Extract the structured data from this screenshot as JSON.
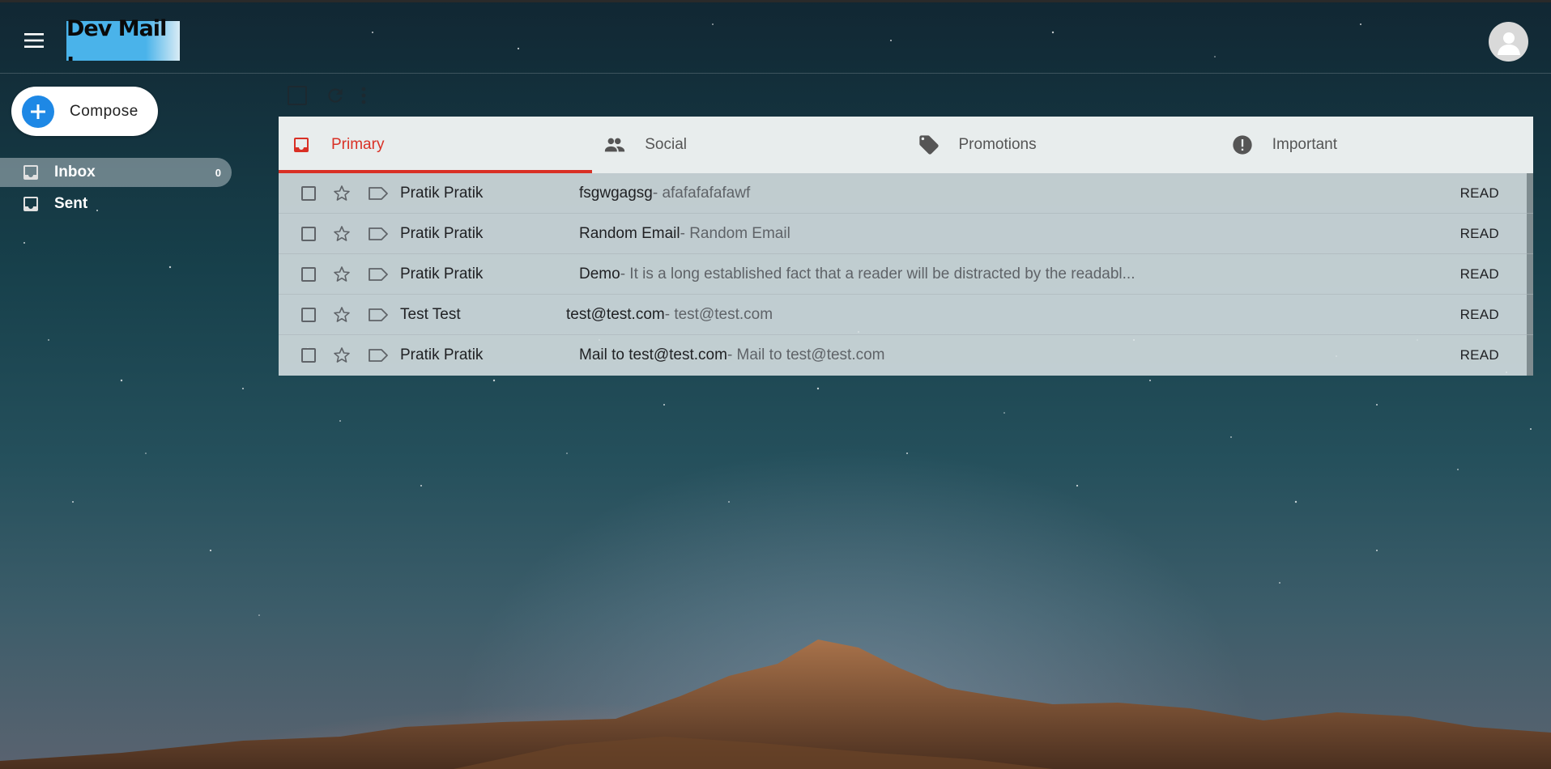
{
  "app": {
    "logo_text": "Dev Mail .",
    "menu_icon": "hamburger-menu-icon",
    "avatar_icon": "account-circle-icon"
  },
  "sidebar": {
    "compose_label": "Compose",
    "items": [
      {
        "label": "Inbox",
        "count": "0",
        "icon": "inbox-icon",
        "active": true
      },
      {
        "label": "Sent",
        "count": "",
        "icon": "inbox-icon",
        "active": false
      }
    ]
  },
  "toolbar": {
    "select_all_icon": "checkbox-icon",
    "refresh_icon": "refresh-icon",
    "more_icon": "more-vert-icon"
  },
  "tabs": [
    {
      "label": "Primary",
      "icon": "inbox-tab-icon",
      "active": true
    },
    {
      "label": "Social",
      "icon": "people-icon",
      "active": false
    },
    {
      "label": "Promotions",
      "icon": "tag-icon",
      "active": false
    },
    {
      "label": "Important",
      "icon": "info-icon",
      "active": false
    }
  ],
  "emails": [
    {
      "sender": "Pratik Pratik",
      "subject": "fsgwgagsg",
      "snippet": "- afafafafafawf",
      "status": "READ"
    },
    {
      "sender": "Pratik Pratik",
      "subject": "Random Email",
      "snippet": "- Random Email",
      "status": "READ"
    },
    {
      "sender": "Pratik Pratik",
      "subject": "Demo",
      "snippet": "- It is a long established fact that a reader will be distracted by the readabl...",
      "status": "READ"
    },
    {
      "sender": "Test Test",
      "subject": "test@test.com",
      "snippet": "- test@test.com",
      "status": "READ"
    },
    {
      "sender": "Pratik Pratik",
      "subject": "Mail to test@test.com",
      "snippet": "- Mail to test@test.com",
      "status": "READ"
    }
  ],
  "colors": {
    "accent": "#d93025",
    "compose_blue": "#1e88e5",
    "logo_bg": "#4ab3ea"
  }
}
